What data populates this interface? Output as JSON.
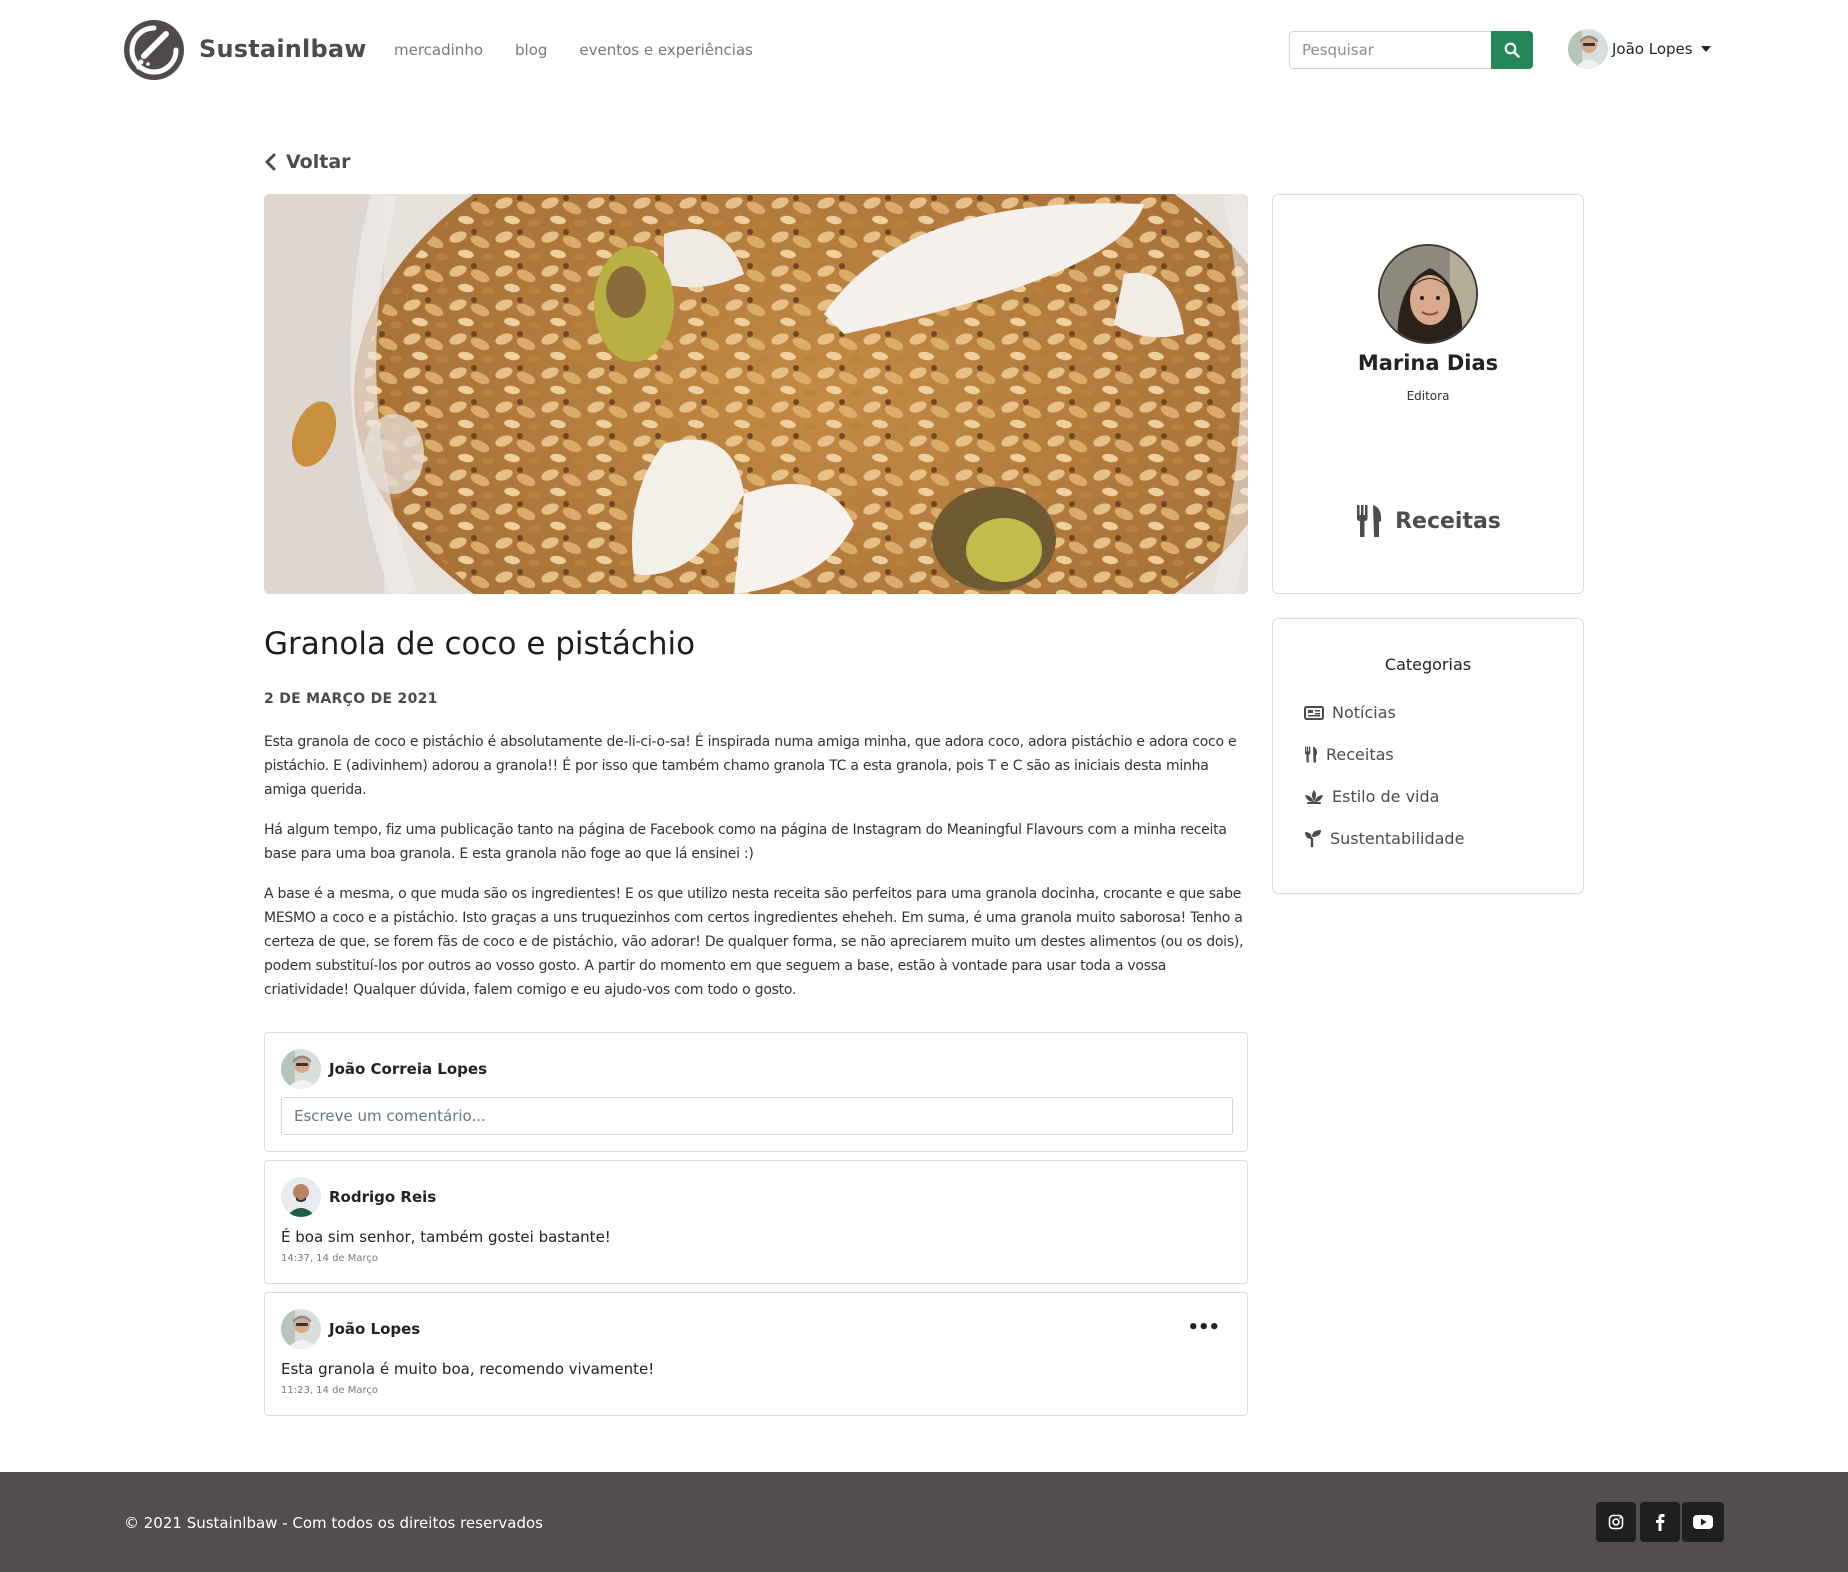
{
  "header": {
    "brand": "Sustainlbaw",
    "nav": [
      "mercadinho",
      "blog",
      "eventos e experiências"
    ],
    "search_placeholder": "Pesquisar",
    "user_name": "João Lopes",
    "icons": [
      "logo-icon",
      "search-icon",
      "caret-down-icon"
    ],
    "accent_color": "#24875a"
  },
  "back_label": "Voltar",
  "article": {
    "title": "Granola de coco e pistáchio",
    "date": "2 DE MARÇO DE 2021",
    "paragraphs": [
      "Esta granola de coco e pistáchio é absolutamente de-li-ci-o-sa! É inspirada numa amiga minha, que adora coco, adora pistáchio e adora coco e pistáchio. E (adivinhem) adorou a granola!! É por isso que também chamo granola TC a esta granola, pois T e C são as iniciais desta minha amiga querida.",
      "Há algum tempo, fiz uma publicação tanto na página de Facebook como na página de Instagram do Meaningful Flavours com a minha receita base para uma boa granola. E esta granola não foge ao que lá ensinei :)",
      "A base é a mesma, o que muda são os ingredientes! E os que utilizo nesta receita são perfeitos para uma granola docinha, crocante e que sabe MESMO a coco e a pistáchio. Isto graças a uns truquezinhos com certos ingredientes eheheh. Em suma, é uma granola muito saborosa! Tenho a certeza de que, se forem fãs de coco e de pistáchio, vão adorar! De qualquer forma, se não apreciarem muito um destes alimentos (ou os dois), podem substituí-los por outros ao vosso gosto. A partir do momento em que seguem a base, estão à vontade para usar toda a vossa criatividade! Qualquer dúvida, falem comigo e eu ajudo-vos com todo o gosto."
    ]
  },
  "comment_form": {
    "author": "João Correia Lopes",
    "placeholder": "Escreve um comentário..."
  },
  "comments": [
    {
      "author": "Rodrigo Reis",
      "text": "É boa sim senhor, também gostei bastante!",
      "time": "14:37, 14 de Março"
    },
    {
      "author": "João Lopes",
      "text": "Esta granola é muito boa, recomendo vivamente!",
      "time": "11:23, 14 de Março",
      "more": "•••"
    }
  ],
  "author_card": {
    "name": "Marina Dias",
    "role": "Editora",
    "category": "Receitas",
    "category_icon": "utensils-icon"
  },
  "categories": {
    "title": "Categorias",
    "items": [
      {
        "label": "Notícias",
        "icon": "newspaper-icon"
      },
      {
        "label": "Receitas",
        "icon": "utensils-icon"
      },
      {
        "label": "Estilo de vida",
        "icon": "spa-icon"
      },
      {
        "label": "Sustentabilidade",
        "icon": "seedling-icon"
      }
    ]
  },
  "footer": {
    "copyright": "© 2021 Sustainlbaw - Com todos os direitos reservados",
    "social": [
      "instagram-icon",
      "facebook-icon",
      "youtube-icon"
    ],
    "background": "#534d4d"
  }
}
